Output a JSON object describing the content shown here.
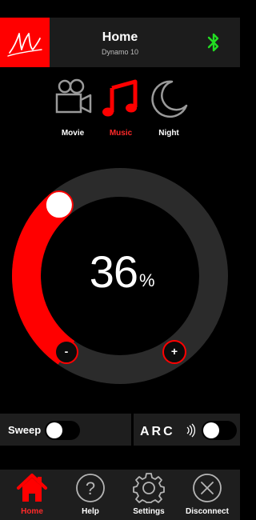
{
  "header": {
    "title": "Home",
    "subtitle": "Dynamo 10",
    "bluetooth_color": "#22dd22",
    "logo_color": "#ff0000"
  },
  "modes": [
    {
      "label": "Movie",
      "icon": "movie-camera-icon",
      "active": false
    },
    {
      "label": "Music",
      "icon": "music-note-icon",
      "active": true
    },
    {
      "label": "Night",
      "icon": "crescent-moon-icon",
      "active": false
    }
  ],
  "volume": {
    "value": "36",
    "unit": "%",
    "level": 0.36,
    "minus_label": "-",
    "plus_label": "+"
  },
  "toggles": {
    "sweep": {
      "label": "Sweep",
      "on": false
    },
    "arc": {
      "label": "ARC",
      "on": false
    }
  },
  "nav": [
    {
      "label": "Home",
      "icon": "home-icon",
      "active": true
    },
    {
      "label": "Help",
      "icon": "help-icon",
      "active": false
    },
    {
      "label": "Settings",
      "icon": "settings-gear-icon",
      "active": false
    },
    {
      "label": "Disconnect",
      "icon": "disconnect-icon",
      "active": false
    }
  ],
  "colors": {
    "accent": "#ff0000",
    "track": "#2b2b2b",
    "panel": "#1e1e1e"
  }
}
